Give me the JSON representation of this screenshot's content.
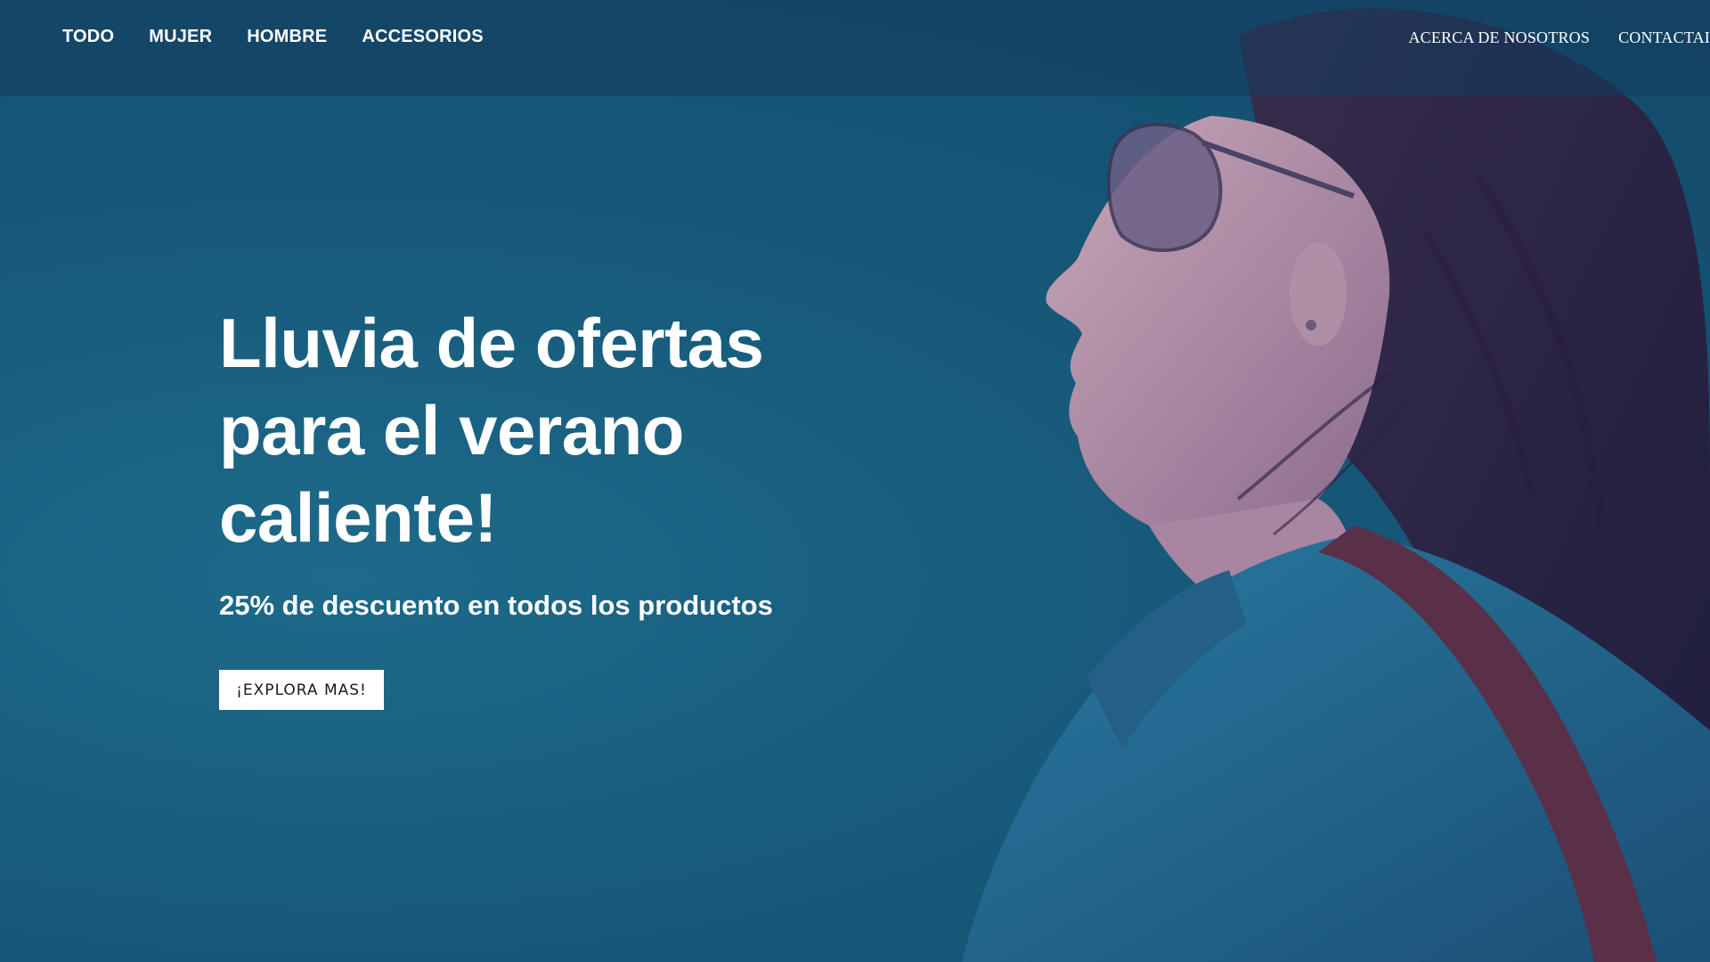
{
  "nav": {
    "left_items": [
      {
        "label": "TODO"
      },
      {
        "label": "MUJER"
      },
      {
        "label": "HOMBRE"
      },
      {
        "label": "ACCESORIOS"
      }
    ],
    "right_items": [
      {
        "label": "ACERCA DE NOSOTROS"
      },
      {
        "label": "CONTACTAI"
      }
    ]
  },
  "hero": {
    "headline": "Lluvia de ofertas para el verano caliente!",
    "subheadline": "25% de descuento en todos los productos",
    "cta_label": "¡EXPLORA MAS!",
    "photo_semantic": "woman-in-sunglasses-profile-photo"
  },
  "colors": {
    "background": "#17597a",
    "nav_overlay": "#143c5f",
    "text": "#ffffff",
    "button_bg": "#ffffff",
    "button_text": "#1a1a1a"
  }
}
